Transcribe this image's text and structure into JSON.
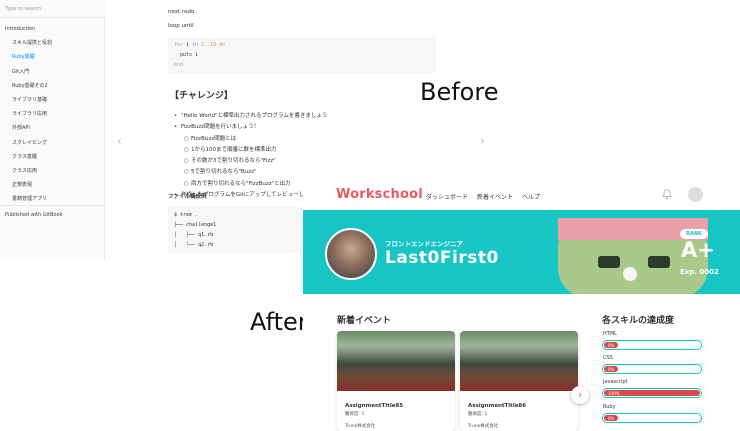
{
  "labels": {
    "before": "Before",
    "after": "After"
  },
  "gitbook": {
    "search_placeholder": "Type to search",
    "nav": [
      {
        "label": "Introduction",
        "level": 0,
        "active": false
      },
      {
        "label": "スキル提携と役割",
        "level": 1,
        "active": false
      },
      {
        "label": "Ruby基礎",
        "level": 1,
        "active": true
      },
      {
        "label": "Git入門",
        "level": 1,
        "active": false
      },
      {
        "label": "Ruby基礎その2",
        "level": 1,
        "active": false
      },
      {
        "label": "ライブラリ基礎",
        "level": 1,
        "active": false
      },
      {
        "label": "ライブラリ応用",
        "level": 1,
        "active": false
      },
      {
        "label": "外部API",
        "level": 1,
        "active": false
      },
      {
        "label": "スクレイピング",
        "level": 1,
        "active": false
      },
      {
        "label": "クラス基礎",
        "level": 1,
        "active": false
      },
      {
        "label": "クラス応用",
        "level": 1,
        "active": false
      },
      {
        "label": "正規表現",
        "level": 1,
        "active": false
      },
      {
        "label": "書籍管理アプリ",
        "level": 1,
        "active": false
      }
    ],
    "published": "Published with GitBook",
    "text_next_redo": "next redo",
    "text_loop_until": "loop until",
    "code1": {
      "line1_kw1": "for",
      "line1_var": " i ",
      "line1_kw2": "in",
      "line1_range": " 1..10 ",
      "line1_kw3": "do",
      "line2": "  puts i",
      "line3": "end"
    },
    "challenge_heading": "【チャレンジ】",
    "list": [
      {
        "text": "\"Hello World\"と標準出力されるプログラムを書きましょう",
        "sub": false,
        "bullet": "•"
      },
      {
        "text": "FizzBuzz問題を行いましょう！",
        "sub": false,
        "bullet": "•"
      },
      {
        "text": "FizzBuzz問題とは",
        "sub": true,
        "bullet": "○"
      },
      {
        "text": "1から100まで順番に数を標準出力",
        "sub": true,
        "bullet": "○"
      },
      {
        "text": "その数が3で割り切れるなら\"Fizz\"",
        "sub": true,
        "bullet": "○"
      },
      {
        "text": "5で割り切れるなら\"Buzz\"",
        "sub": true,
        "bullet": "○"
      },
      {
        "text": "両方で割り切れるなら\"FizzBuzz\"と出力",
        "sub": true,
        "bullet": "○"
      },
      {
        "text": "作成したプログラムをGitにアップしてレビューし",
        "sub": false,
        "bullet": "•"
      }
    ],
    "file_structure_heading": "ファイル構成例",
    "code2": [
      "$ tree .",
      "├── challenge1",
      "│   ├── q1.rb",
      "│   └── q2.rb"
    ]
  },
  "workschool": {
    "logo": "Workschool",
    "nav": [
      "ダッシュボード",
      "新着イベント",
      "ヘルプ"
    ],
    "banner": {
      "subtitle": "フロントエンドエンジニア",
      "name": "Last0First0",
      "rank_label": "RANK",
      "rank": "A+",
      "exp": "Exp. 0002"
    },
    "events_title": "新着イベント",
    "events": [
      {
        "title": "AssignmentTitle85",
        "sub": "難易度: 1",
        "company": "Trunk株式会社"
      },
      {
        "title": "AssignmentTitle86",
        "sub": "難易度: 1",
        "company": "Trunk株式会社"
      }
    ],
    "next_arrow": "›",
    "skills_title": "各スキルの達成度",
    "skills": [
      {
        "label": "HTML",
        "percent": 0,
        "pct_text": "0%"
      },
      {
        "label": "CSS",
        "percent": 0,
        "pct_text": "0%"
      },
      {
        "label": "Javascript",
        "percent": 100,
        "pct_text": "100%"
      },
      {
        "label": "Ruby",
        "percent": 0,
        "pct_text": "0%"
      }
    ],
    "colors": {
      "brand": "#e65c5c",
      "banner": "#17c6c4",
      "skill_fill": "#d94a4a"
    }
  }
}
